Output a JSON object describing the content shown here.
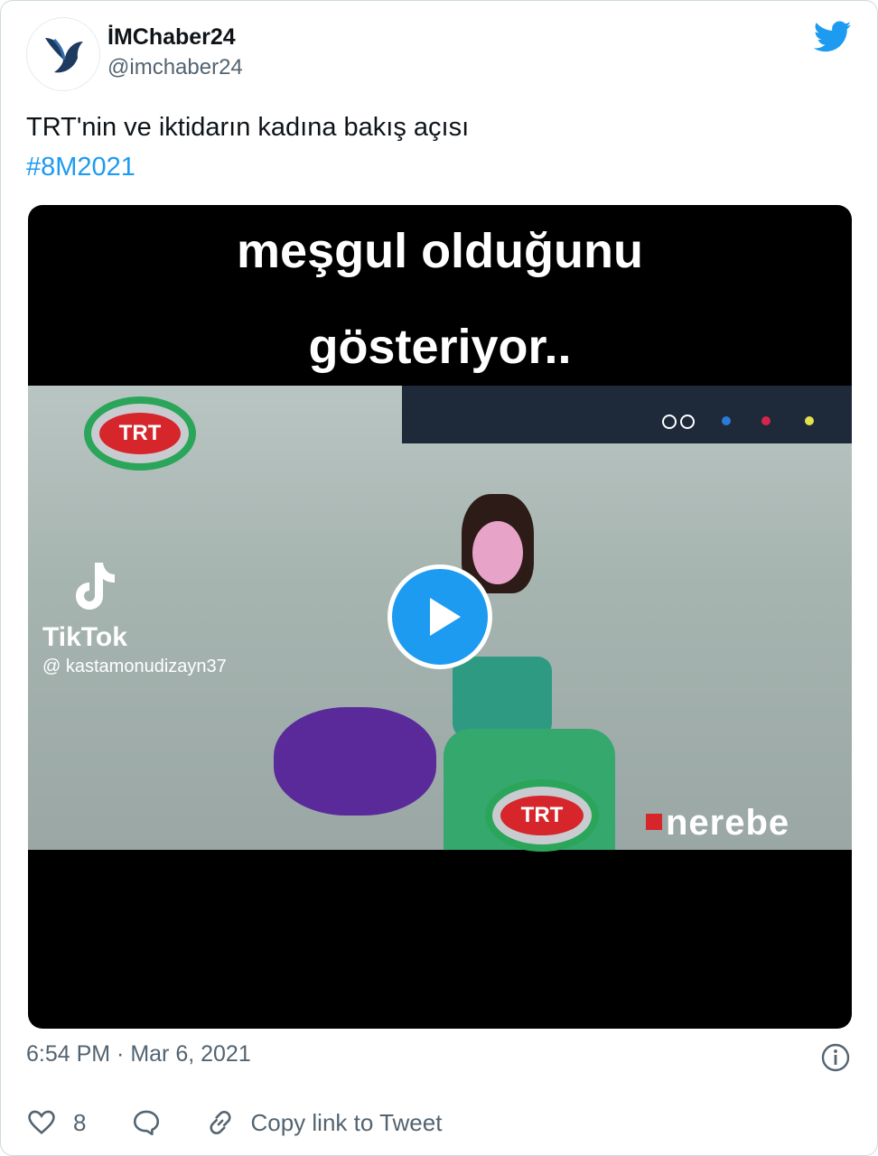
{
  "tweet": {
    "author_name": "İMChaber24",
    "author_handle": "@imchaber24",
    "text": "TRT'nin ve iktidarın kadına bakış açısı",
    "hashtag": "#8M2021",
    "timestamp": "6:54 PM · Mar 6, 2021",
    "like_count": "8",
    "copy_link_label": "Copy link to Tweet"
  },
  "media": {
    "caption_line1": "meşgul olduğunu",
    "caption_line2": "gösteriyor..",
    "trt_logo_text": "TRT",
    "tiktok_label": "TikTok",
    "tiktok_user": "@ kastamonudizayn37",
    "watermark": "nerebe"
  },
  "icons": {
    "brand": "twitter-bird-icon",
    "play": "play-icon",
    "info": "info-icon",
    "like": "heart-icon",
    "reply": "reply-icon",
    "link": "link-icon"
  },
  "colors": {
    "accent": "#1d9bf0",
    "text": "#0f1419",
    "secondary": "#536471"
  }
}
